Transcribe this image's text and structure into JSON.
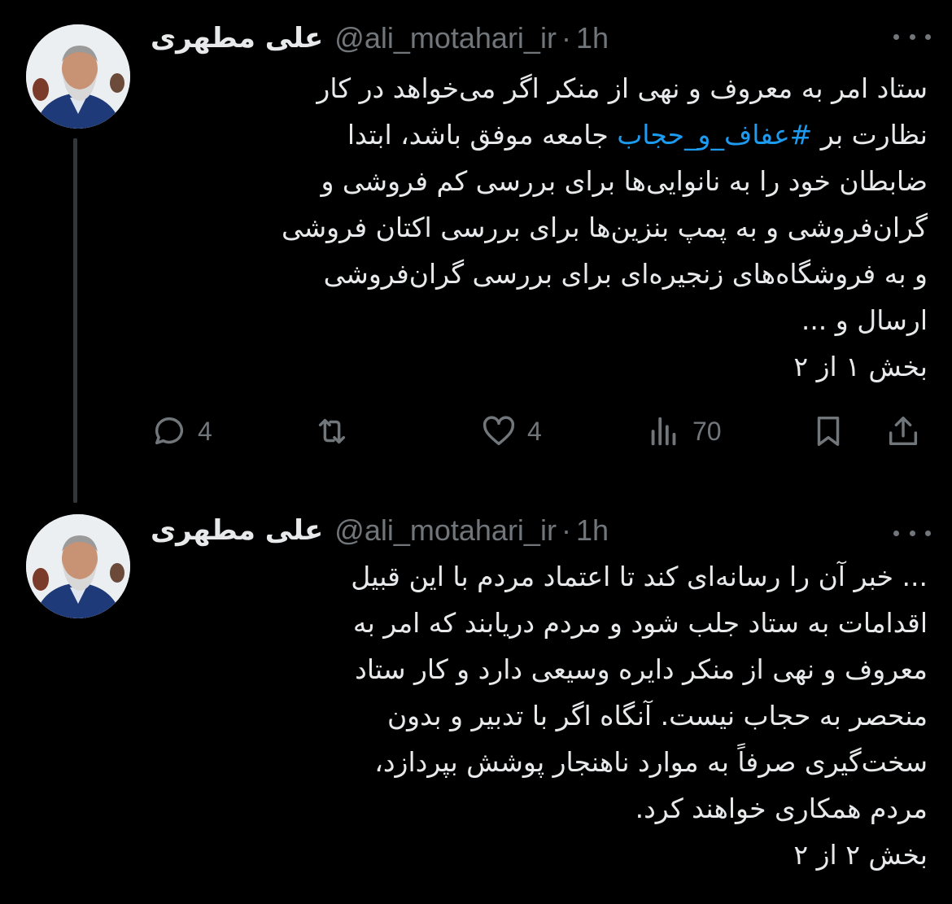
{
  "tweets": [
    {
      "author_name": "علی مطهری",
      "handle": "@ali_motahari_ir",
      "separator": "·",
      "time": "1h",
      "text_lines": [
        "ستاد امر به معروف و نهی از منکر اگر می‌خواهد در کار",
        "جامعه موفق باشد، ابتدا",
        "ضابطان خود را به نانوایی‌ها برای بررسی کم فروشی و",
        "گران‌فروشی و به پمپ بنزین‌ها برای بررسی اکتان فروشی",
        "و به فروشگاه‌های زنجیره‌ای برای بررسی گران‌فروشی",
        "ارسال و ...",
        "بخش ۱ از ۲"
      ],
      "line2_prefix": "نظارت بر",
      "hashtag": "#عفاف_و_حجاب",
      "replies": "4",
      "reposts": "",
      "likes": "4",
      "views": "70"
    },
    {
      "author_name": "علی مطهری",
      "handle": "@ali_motahari_ir",
      "separator": "·",
      "time": "1h",
      "text_lines": [
        "... خبر آن را رسانه‌ای کند تا اعتماد مردم با این قبیل",
        "اقدامات به ستاد جلب شود و مردم دریابند که امر به",
        "معروف و نهی از منکر دایره وسیعی دارد و کار ستاد",
        "منحصر به حجاب نیست. آنگاه اگر با تدبیر و بدون",
        "سخت‌گیری صرفاً به موارد ناهنجار پوشش بپردازد،",
        "مردم همکاری خواهند کرد.",
        "بخش ۲ از ۲"
      ]
    }
  ],
  "colors": {
    "background": "#000000",
    "text": "#e7e9ea",
    "secondary": "#71767b",
    "link": "#1d9bf0"
  },
  "icons": [
    "reply-icon",
    "repost-icon",
    "like-icon",
    "views-icon",
    "bookmark-icon",
    "share-icon",
    "more-icon"
  ]
}
